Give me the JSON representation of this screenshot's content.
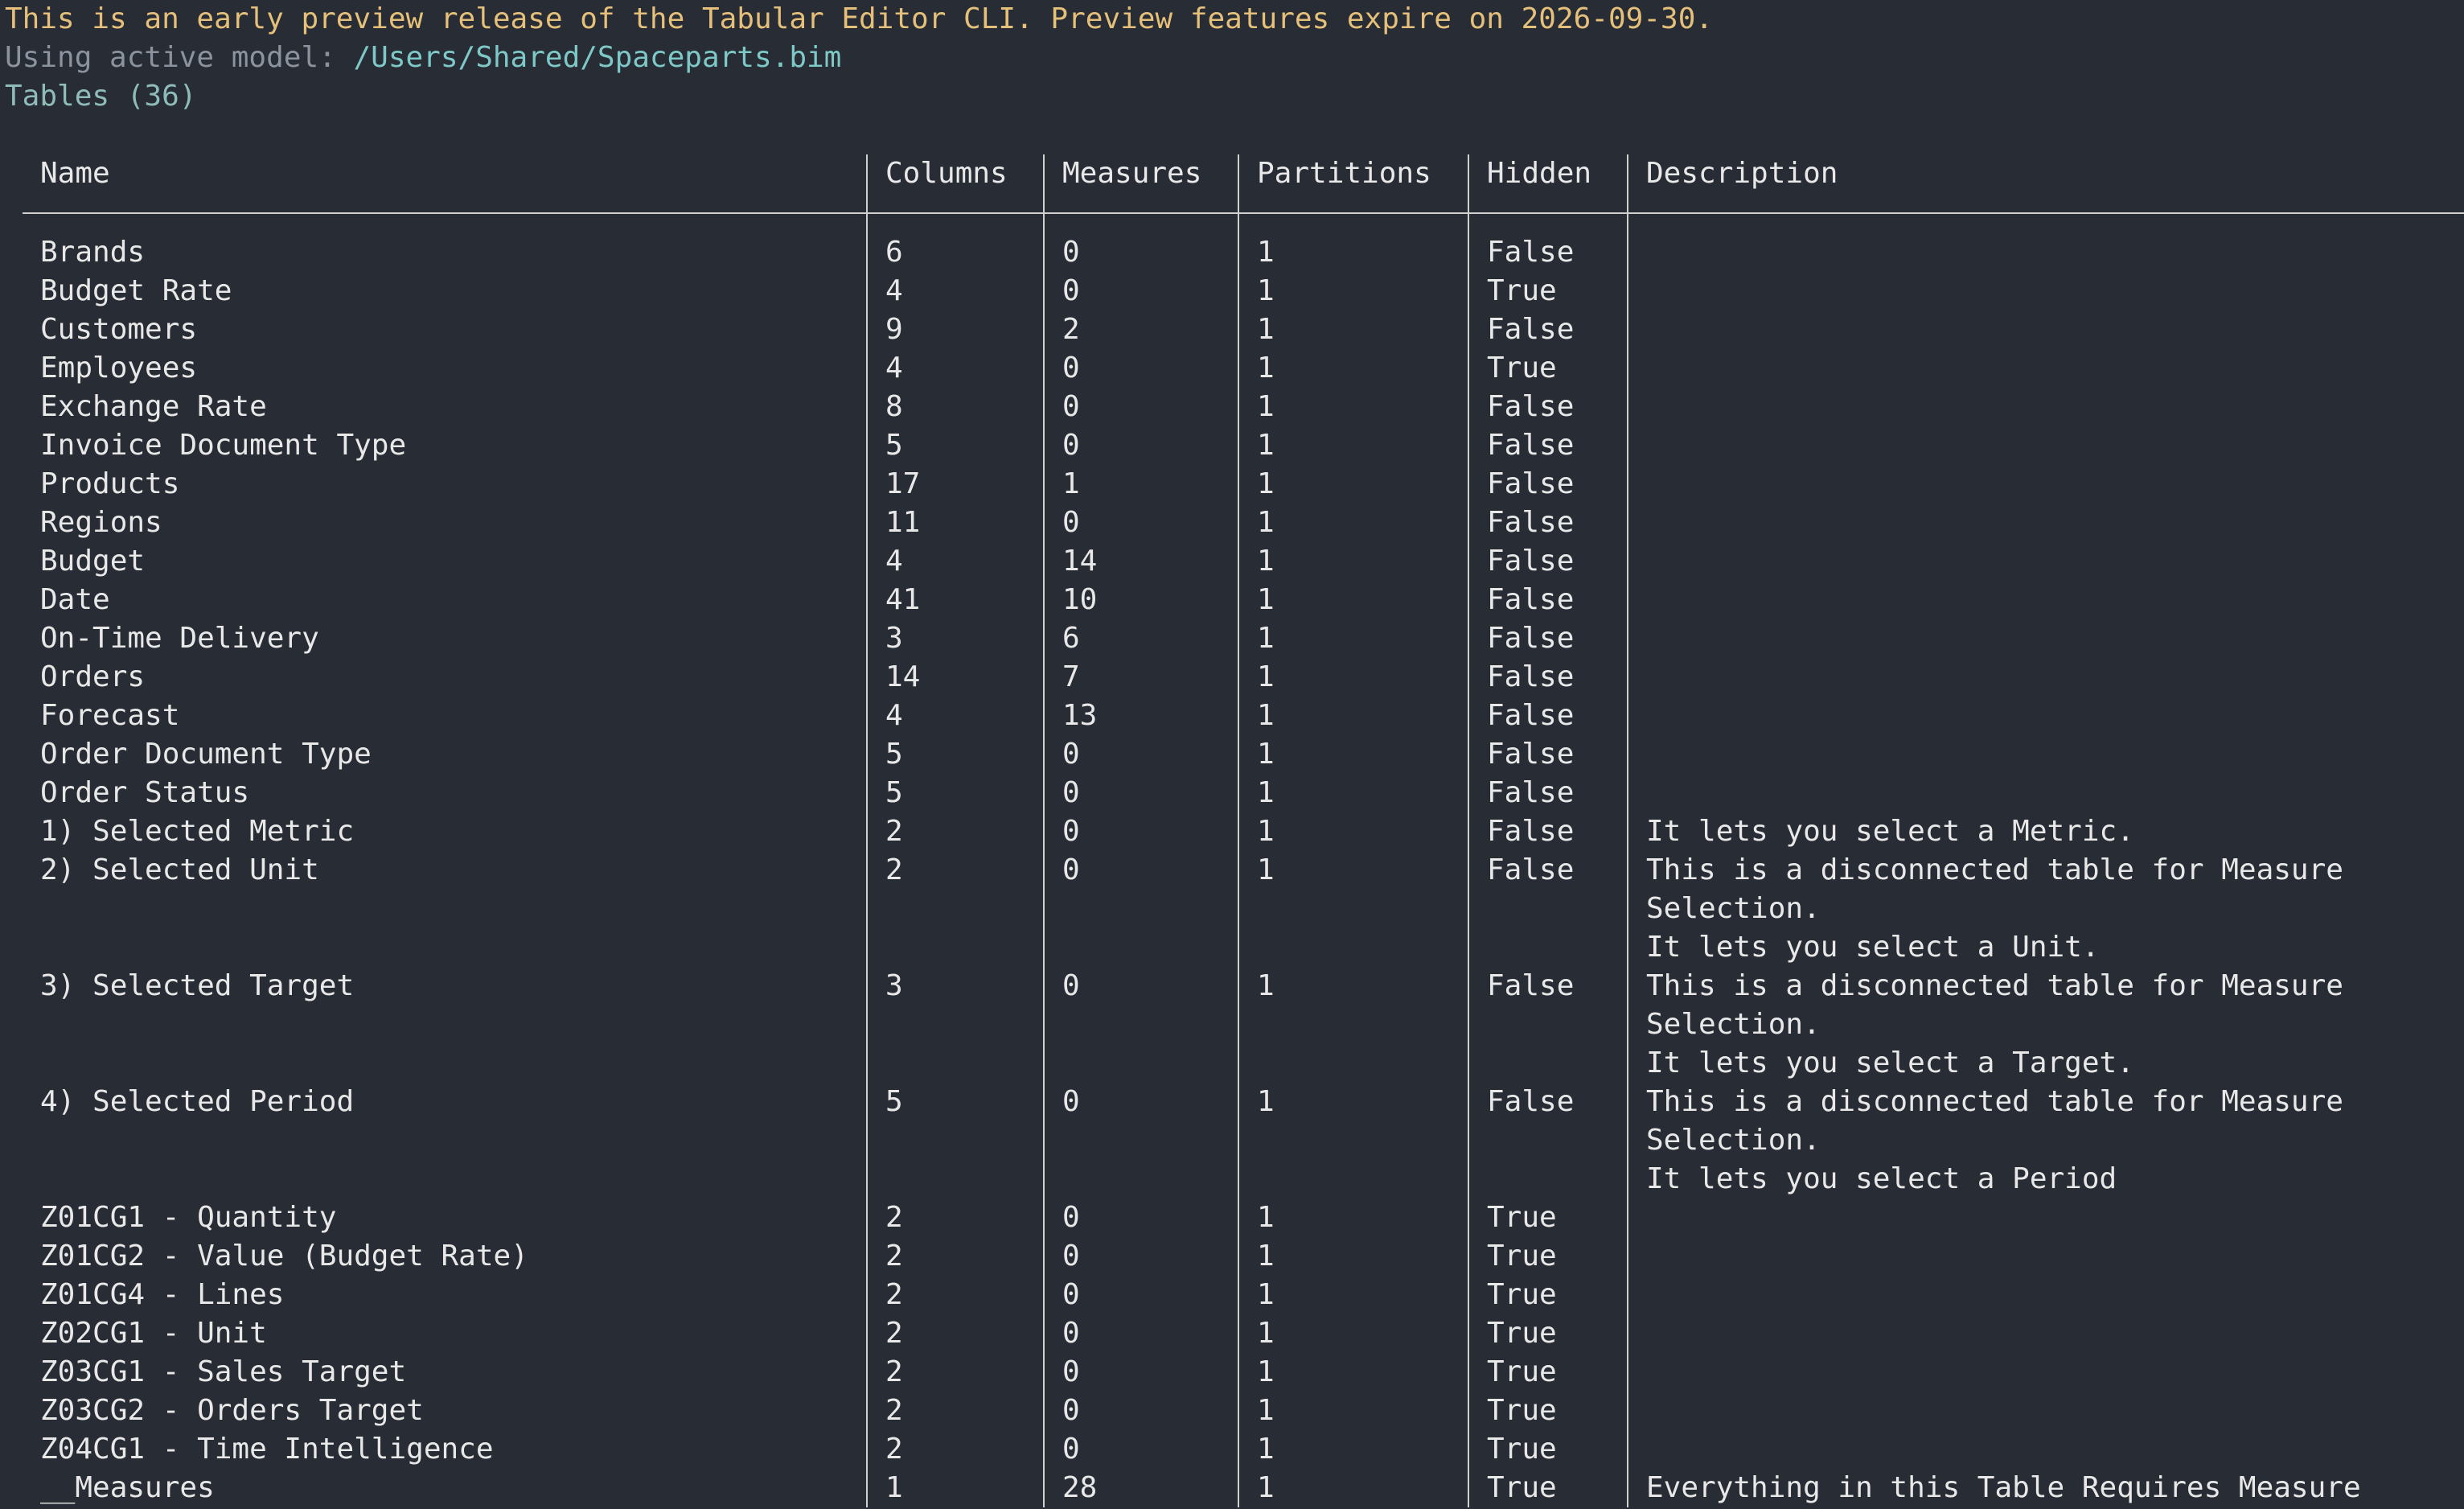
{
  "header": {
    "preview_notice": "This is an early preview release of the Tabular Editor CLI. Preview features expire on 2026-09-30.",
    "model_prefix": "Using active model: ",
    "model_path": "/Users/Shared/Spaceparts.bim",
    "tables_title": "Tables (36)"
  },
  "colors": {
    "background": "#282c34",
    "warning": "#e5c07b",
    "dim": "#8b939e",
    "path": "#7ec8c8"
  },
  "table": {
    "headers": [
      "Name",
      "Columns",
      "Measures",
      "Partitions",
      "Hidden",
      "Description"
    ],
    "rows": [
      {
        "name": "Brands",
        "columns": "6",
        "measures": "0",
        "partitions": "1",
        "hidden": "False",
        "description": ""
      },
      {
        "name": "Budget Rate",
        "columns": "4",
        "measures": "0",
        "partitions": "1",
        "hidden": "True",
        "description": ""
      },
      {
        "name": "Customers",
        "columns": "9",
        "measures": "2",
        "partitions": "1",
        "hidden": "False",
        "description": ""
      },
      {
        "name": "Employees",
        "columns": "4",
        "measures": "0",
        "partitions": "1",
        "hidden": "True",
        "description": ""
      },
      {
        "name": "Exchange Rate",
        "columns": "8",
        "measures": "0",
        "partitions": "1",
        "hidden": "False",
        "description": ""
      },
      {
        "name": "Invoice Document Type",
        "columns": "5",
        "measures": "0",
        "partitions": "1",
        "hidden": "False",
        "description": ""
      },
      {
        "name": "Products",
        "columns": "17",
        "measures": "1",
        "partitions": "1",
        "hidden": "False",
        "description": ""
      },
      {
        "name": "Regions",
        "columns": "11",
        "measures": "0",
        "partitions": "1",
        "hidden": "False",
        "description": ""
      },
      {
        "name": "Budget",
        "columns": "4",
        "measures": "14",
        "partitions": "1",
        "hidden": "False",
        "description": ""
      },
      {
        "name": "Date",
        "columns": "41",
        "measures": "10",
        "partitions": "1",
        "hidden": "False",
        "description": ""
      },
      {
        "name": "On-Time Delivery",
        "columns": "3",
        "measures": "6",
        "partitions": "1",
        "hidden": "False",
        "description": ""
      },
      {
        "name": "Orders",
        "columns": "14",
        "measures": "7",
        "partitions": "1",
        "hidden": "False",
        "description": ""
      },
      {
        "name": "Forecast",
        "columns": "4",
        "measures": "13",
        "partitions": "1",
        "hidden": "False",
        "description": ""
      },
      {
        "name": "Order Document Type",
        "columns": "5",
        "measures": "0",
        "partitions": "1",
        "hidden": "False",
        "description": ""
      },
      {
        "name": "Order Status",
        "columns": "5",
        "measures": "0",
        "partitions": "1",
        "hidden": "False",
        "description": ""
      },
      {
        "name": "1) Selected Metric",
        "columns": "2",
        "measures": "0",
        "partitions": "1",
        "hidden": "False",
        "description": "It lets you select a Metric."
      },
      {
        "name": "2) Selected Unit",
        "columns": "2",
        "measures": "0",
        "partitions": "1",
        "hidden": "False",
        "description": "This is a disconnected table for Measure\nSelection.\nIt lets you select a Unit."
      },
      {
        "name": "3) Selected Target",
        "columns": "3",
        "measures": "0",
        "partitions": "1",
        "hidden": "False",
        "description": "This is a disconnected table for Measure\nSelection.\nIt lets you select a Target."
      },
      {
        "name": "4) Selected Period",
        "columns": "5",
        "measures": "0",
        "partitions": "1",
        "hidden": "False",
        "description": "This is a disconnected table for Measure\nSelection.\nIt lets you select a Period"
      },
      {
        "name": "Z01CG1 - Quantity",
        "columns": "2",
        "measures": "0",
        "partitions": "1",
        "hidden": "True",
        "description": ""
      },
      {
        "name": "Z01CG2 - Value (Budget Rate)",
        "columns": "2",
        "measures": "0",
        "partitions": "1",
        "hidden": "True",
        "description": ""
      },
      {
        "name": "Z01CG4 - Lines",
        "columns": "2",
        "measures": "0",
        "partitions": "1",
        "hidden": "True",
        "description": ""
      },
      {
        "name": "Z02CG1 - Unit",
        "columns": "2",
        "measures": "0",
        "partitions": "1",
        "hidden": "True",
        "description": ""
      },
      {
        "name": "Z03CG1 - Sales Target",
        "columns": "2",
        "measures": "0",
        "partitions": "1",
        "hidden": "True",
        "description": ""
      },
      {
        "name": "Z03CG2 - Orders Target",
        "columns": "2",
        "measures": "0",
        "partitions": "1",
        "hidden": "True",
        "description": ""
      },
      {
        "name": "Z04CG1 - Time Intelligence",
        "columns": "2",
        "measures": "0",
        "partitions": "1",
        "hidden": "True",
        "description": ""
      },
      {
        "name": "__Measures",
        "columns": "1",
        "measures": "28",
        "partitions": "1",
        "hidden": "True",
        "description": "Everything in this Table Requires Measure"
      }
    ]
  }
}
